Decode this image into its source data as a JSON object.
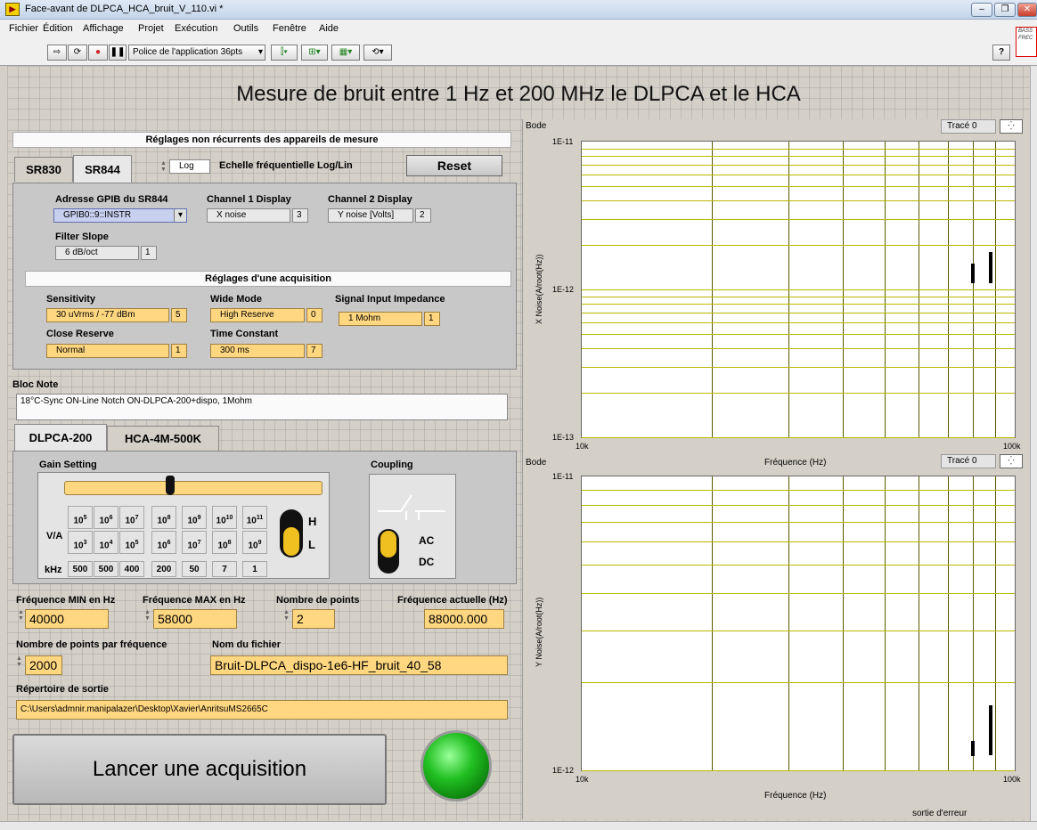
{
  "window": {
    "title": "Face-avant de DLPCA_HCA_bruit_V_110.vi *",
    "minimize": "–",
    "restore": "❐",
    "close": "✕"
  },
  "menu": [
    "Fichier",
    "Édition",
    "Affichage",
    "Projet",
    "Exécution",
    "Outils",
    "Fenêtre",
    "Aide"
  ],
  "toolbar": {
    "font_label": "Police de l'application 36pts",
    "help": "?"
  },
  "redbox_text": [
    "BASS",
    "FREC"
  ],
  "main_title": "Mesure de bruit entre 1 Hz et 200 MHz le DLPCA et le HCA",
  "settings": {
    "header": "Réglages non récurrents des appareils de mesure",
    "tabs": [
      "SR830",
      "SR844"
    ],
    "scale_value": "Log",
    "scale_label": "Echelle fréquentielle Log/Lin",
    "reset": "Reset",
    "gpib_label": "Adresse GPIB du SR844",
    "gpib_value": "GPIB0::9::INSTR",
    "ch1_label": "Channel 1 Display",
    "ch1_value": "X noise",
    "ch1_num": "3",
    "ch2_label": "Channel 2 Display",
    "ch2_value": "Y noise [Volts]",
    "ch2_num": "2",
    "filter_label": "Filter Slope",
    "filter_value": "6 dB/oct",
    "filter_num": "1",
    "acq_header": "Réglages d'une acquisition",
    "sens_label": "Sensitivity",
    "sens_value": "30 uVrms / -77 dBm",
    "sens_num": "5",
    "wide_label": "Wide Mode",
    "wide_value": "High Reserve",
    "wide_num": "0",
    "imp_label": "Signal Input Impedance",
    "imp_value": "1 Mohm",
    "imp_num": "1",
    "close_label": "Close Reserve",
    "close_value": "Normal",
    "close_num": "1",
    "tc_label": "Time Constant",
    "tc_value": "300 ms",
    "tc_num": "7"
  },
  "bloc_note": {
    "label": "Bloc Note",
    "text": "18°C-Sync ON-Line Notch ON-DLPCA-200+dispo, 1Mohm"
  },
  "amp": {
    "tabs": [
      "DLPCA-200",
      "HCA-4M-500K"
    ],
    "gain_label": "Gain Setting",
    "coupling_label": "Coupling",
    "va": "V/A",
    "khz": "kHz",
    "row_h": [
      "10^5",
      "10^6",
      "10^7",
      "10^8",
      "10^9",
      "10^10",
      "10^11"
    ],
    "row_l": [
      "10^3",
      "10^4",
      "10^5",
      "10^6",
      "10^7",
      "10^8",
      "10^9"
    ],
    "bw": [
      "500",
      "500",
      "400",
      "200",
      "50",
      "7",
      "1"
    ],
    "hl": [
      "H",
      "L"
    ],
    "acdc": [
      "AC",
      "DC"
    ]
  },
  "freq": {
    "min_label": "Fréquence MIN en Hz",
    "min_value": "40000",
    "max_label": "Fréquence MAX en Hz",
    "max_value": "58000",
    "npts_label": "Nombre de points",
    "npts_value": "2",
    "cur_label": "Fréquence actuelle (Hz)",
    "cur_value": "88000.000",
    "pts_per_label": "Nombre de points par fréquence",
    "pts_per_value": "2000",
    "file_label": "Nom du fichier",
    "file_value": "Bruit-DLPCA_dispo-1e6-HF_bruit_40_58",
    "dir_label": "Répertoire de sortie",
    "dir_value": "C:\\Users\\admnir.manipalazer\\Desktop\\Xavier\\AnritsuMS2665C"
  },
  "launch": "Lancer une acquisition",
  "error_label": "sortie d'erreur",
  "chart_data": [
    {
      "type": "scatter",
      "title": "Bode",
      "legend": "Tracé 0",
      "xlabel": "Fréquence (Hz)",
      "ylabel": "X Noise(A/root(Hz))",
      "x_scale": "log",
      "y_scale": "log",
      "xlim": [
        10000,
        100000
      ],
      "ylim": [
        1e-13,
        1e-11
      ],
      "x_ticks": [
        "10k",
        "100k"
      ],
      "y_ticks": [
        "1E-11",
        "1E-12",
        "1E-13"
      ],
      "segments": [
        {
          "x": 80000,
          "y_min": 1.1e-12,
          "y_max": 1.5e-12
        },
        {
          "x": 88000,
          "y_min": 1.1e-12,
          "y_max": 1.8e-12
        }
      ]
    },
    {
      "type": "scatter",
      "title": "Bode",
      "legend": "Tracé 0",
      "xlabel": "Fréquence (Hz)",
      "ylabel": "Y Noise(A/root(Hz))",
      "x_scale": "log",
      "y_scale": "log",
      "xlim": [
        10000,
        100000
      ],
      "y_ticks": [
        "1E-11",
        "1E-12"
      ],
      "segments": [
        {
          "x": 80000,
          "y_frac_min": 0.05,
          "y_frac_max": 0.1
        },
        {
          "x": 88000,
          "y_frac_min": 0.05,
          "y_frac_max": 0.22
        }
      ]
    }
  ]
}
